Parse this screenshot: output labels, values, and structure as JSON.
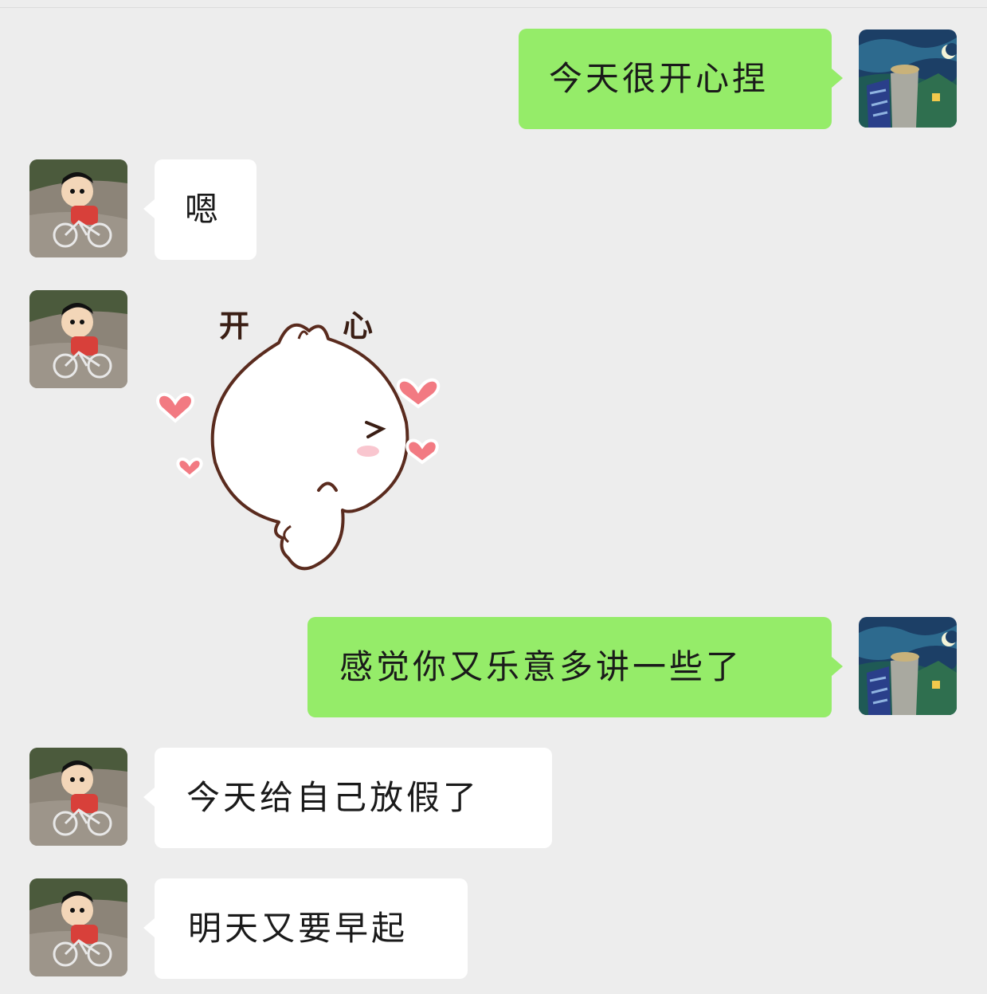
{
  "chat": {
    "messages": [
      {
        "side": "me",
        "type": "text",
        "text": "今天很开心捏"
      },
      {
        "side": "other",
        "type": "text",
        "text": "嗯"
      },
      {
        "side": "other",
        "type": "sticker",
        "caption_left": "开",
        "caption_right": "心"
      },
      {
        "side": "me",
        "type": "text",
        "text": "感觉你又乐意多讲一些了"
      },
      {
        "side": "other",
        "type": "text",
        "text": "今天给自己放假了"
      },
      {
        "side": "other",
        "type": "text",
        "text": "明天又要早起"
      }
    ]
  },
  "colors": {
    "background": "#ededed",
    "my_bubble": "#95ec69",
    "other_bubble": "#ffffff",
    "heart": "#f27a82"
  },
  "icons": {
    "my_avatar": "starry-night-traveler-avatar-icon",
    "other_avatar": "boy-on-bicycle-avatar-icon"
  }
}
